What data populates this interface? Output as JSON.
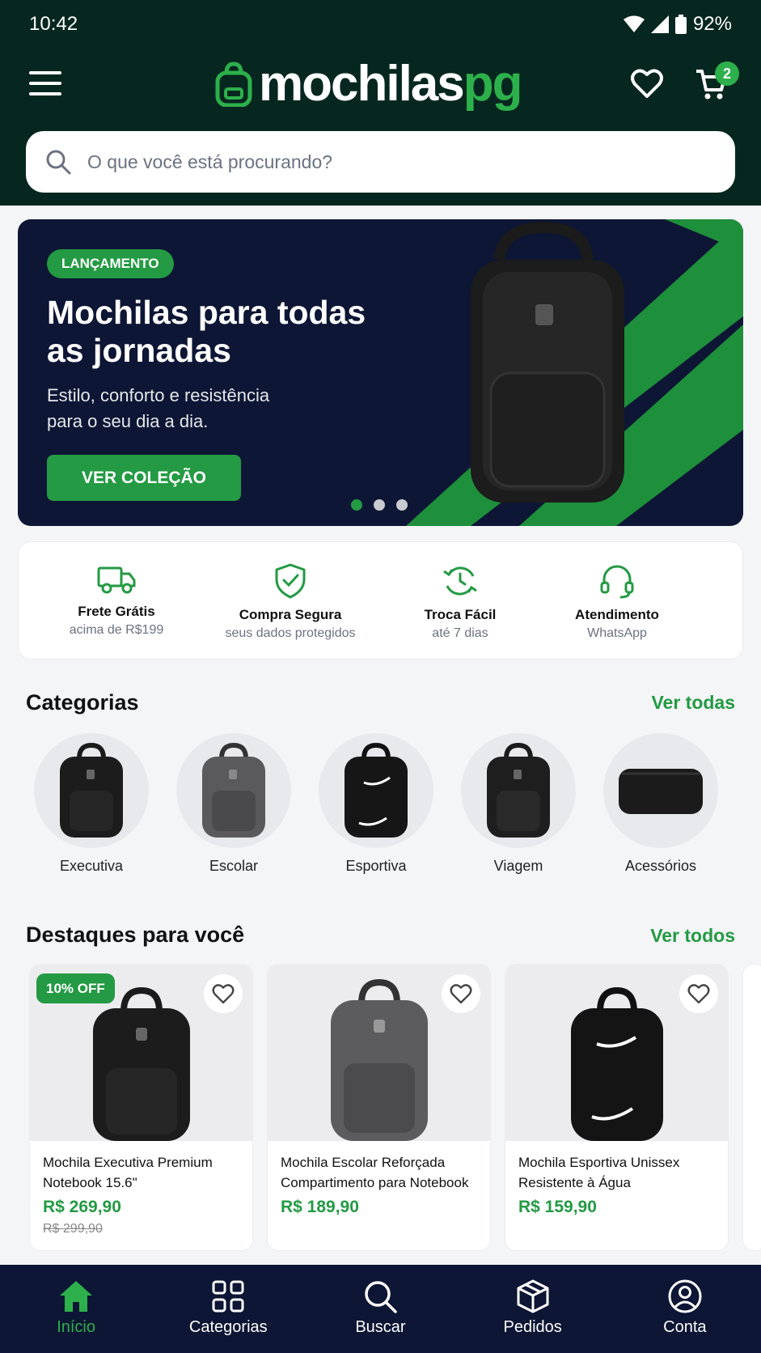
{
  "status_bar": {
    "time": "10:42",
    "battery": "92%"
  },
  "header": {
    "logo_main": "mochilas",
    "logo_accent": "pg",
    "cart_count": "2"
  },
  "search": {
    "placeholder": "O que você está procurando?"
  },
  "banner": {
    "badge": "LANÇAMENTO",
    "title": "Mochilas para todas as jornadas",
    "subtitle": "Estilo, conforto e resistência para o seu dia a dia.",
    "cta": "VER COLEÇÃO",
    "slide_count": 3,
    "active_slide": 1
  },
  "features": [
    {
      "icon": "truck-icon",
      "title": "Frete Grátis",
      "subtitle": "acima de R$199"
    },
    {
      "icon": "shield-check-icon",
      "title": "Compra Segura",
      "subtitle": "seus dados protegidos"
    },
    {
      "icon": "exchange-icon",
      "title": "Troca Fácil",
      "subtitle": "até 7 dias"
    },
    {
      "icon": "headset-icon",
      "title": "Atendimento",
      "subtitle": "WhatsApp"
    }
  ],
  "categories": {
    "title": "Categorias",
    "link": "Ver todas",
    "items": [
      {
        "label": "Executiva"
      },
      {
        "label": "Escolar"
      },
      {
        "label": "Esportiva"
      },
      {
        "label": "Viagem"
      },
      {
        "label": "Acessórios"
      }
    ]
  },
  "highlights": {
    "title": "Destaques para você",
    "link": "Ver todos",
    "products": [
      {
        "name": "Mochila Executiva Premium Notebook 15.6\"",
        "price": "R$ 269,90",
        "old_price": "R$ 299,90",
        "discount": "10% OFF"
      },
      {
        "name": "Mochila Escolar Reforçada Compartimento para Notebook",
        "price": "R$ 189,90"
      },
      {
        "name": "Mochila Esportiva Unissex Resistente à Água",
        "price": "R$ 159,90"
      }
    ]
  },
  "bottom_nav": [
    {
      "label": "Início",
      "icon": "home-icon",
      "active": true
    },
    {
      "label": "Categorias",
      "icon": "grid-icon"
    },
    {
      "label": "Buscar",
      "icon": "search-icon"
    },
    {
      "label": "Pedidos",
      "icon": "box-icon"
    },
    {
      "label": "Conta",
      "icon": "user-icon"
    }
  ],
  "colors": {
    "header_bg": "#06271f",
    "accent": "#239a43",
    "nav_bg": "#0d1634"
  }
}
